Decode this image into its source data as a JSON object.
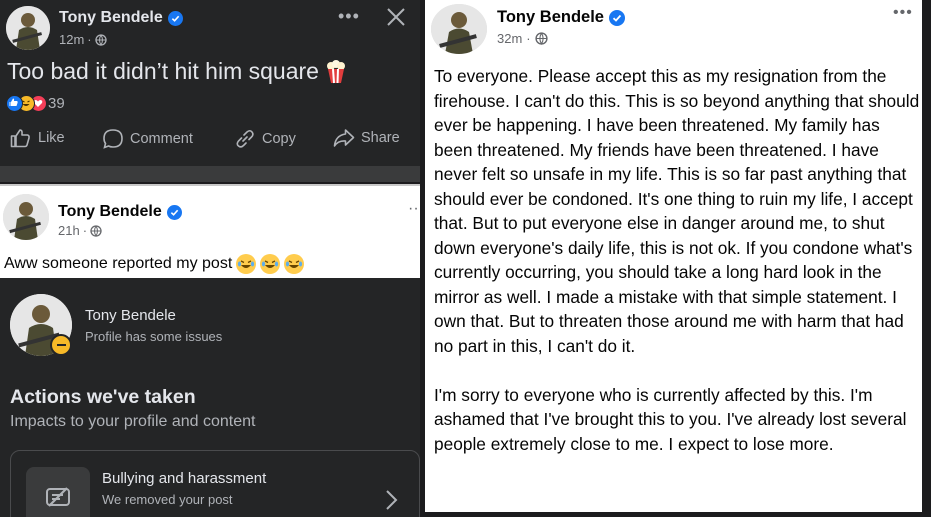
{
  "top_post": {
    "author": "Tony Bendele",
    "time": "12m",
    "text": "Too bad it didn’t hit him square",
    "reaction_count": "39",
    "actions": [
      "Like",
      "Comment",
      "Copy",
      "Share"
    ],
    "icons": [
      "avatar",
      "verified-badge-icon",
      "globe-icon",
      "more-icon",
      "close-icon",
      "popcorn-icon",
      "like-reaction-icon",
      "haha-reaction-icon",
      "love-reaction-icon",
      "like-icon",
      "comment-icon",
      "copy-icon",
      "share-icon"
    ]
  },
  "middle_post": {
    "author": "Tony Bendele",
    "time": "21h",
    "text": "Aww someone reported my post",
    "emoji": [
      "laughing-crying-emoji",
      "laughing-crying-emoji",
      "laughing-crying-emoji"
    ]
  },
  "actions_panel": {
    "name": "Tony Bendele",
    "status": "Profile has some issues",
    "heading": "Actions we've taken",
    "subheading": "Impacts to your profile and content",
    "card_title": "Bullying and harassment",
    "card_subtitle": "We removed your post"
  },
  "long_post": {
    "author": "Tony Bendele",
    "time": "32m",
    "paragraphs": [
      "To everyone. Please accept this as my resignation from the firehouse. I can't do this. This is so beyond anything that should ever be happening. I have been threatened. My family has been threatened. My friends have been threatened. I have never felt so unsafe in my life. This is so far past anything that should ever be condoned. It's one thing to ruin my life, I accept that. But to put everyone else in danger around me, to shut down everyone's daily life, this is not ok. If you condone what's currently occurring, you should take a long hard look in the mirror as well. I made a mistake with that simple statement. I own that. But to threaten those around me with harm that had no part in this, I can't do it.",
      "I'm sorry to everyone who is currently affected by this. I'm ashamed that I've brought this to you. I've already lost several people extremely close to me. I expect to lose more."
    ]
  },
  "colors": {
    "dark_bg": "#242526",
    "verified_blue": "#1877f2",
    "warning_yellow": "#f7b928"
  }
}
